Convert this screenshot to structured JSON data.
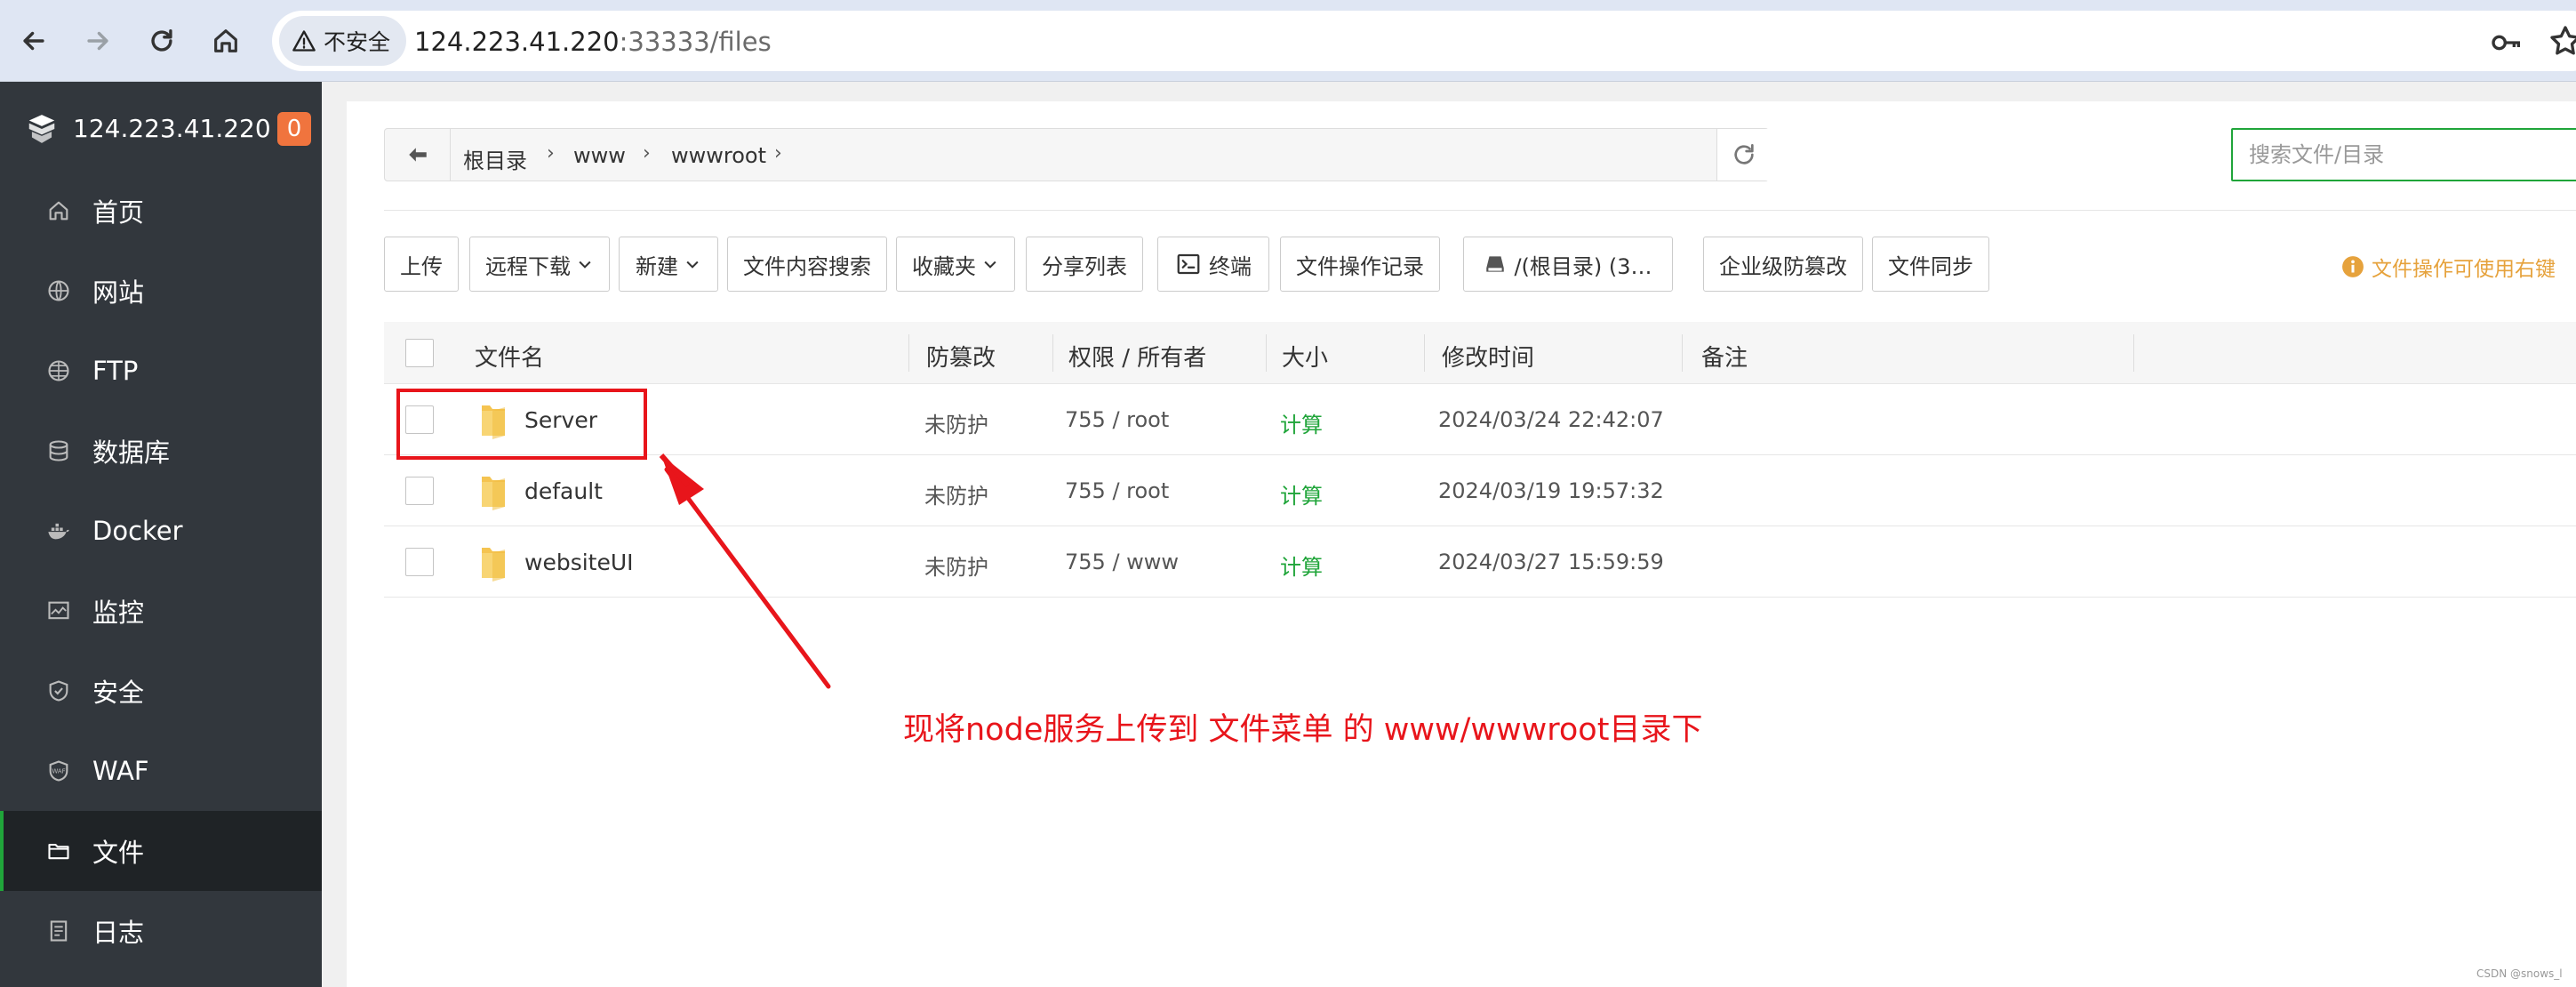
{
  "browser": {
    "security_label": "不安全",
    "url_host": "124.223.41.220",
    "url_rest": ":33333/files"
  },
  "sidebar": {
    "server_ip": "124.223.41.220",
    "badge_count": "0",
    "items": [
      {
        "label": "首页",
        "icon": "home-icon"
      },
      {
        "label": "网站",
        "icon": "globe-icon"
      },
      {
        "label": "FTP",
        "icon": "ftp-globe-icon"
      },
      {
        "label": "数据库",
        "icon": "database-icon"
      },
      {
        "label": "Docker",
        "icon": "docker-icon"
      },
      {
        "label": "监控",
        "icon": "monitor-icon"
      },
      {
        "label": "安全",
        "icon": "shield-icon"
      },
      {
        "label": "WAF",
        "icon": "waf-icon"
      },
      {
        "label": "文件",
        "icon": "folder-icon",
        "active": true
      },
      {
        "label": "日志",
        "icon": "log-icon"
      }
    ]
  },
  "breadcrumb": {
    "items": [
      "根目录",
      "www",
      "wwwroot"
    ]
  },
  "search": {
    "placeholder": "搜索文件/目录"
  },
  "toolbar": {
    "upload": "上传",
    "remote_download": "远程下载",
    "new": "新建",
    "content_search": "文件内容搜索",
    "favorites": "收藏夹",
    "share_list": "分享列表",
    "terminal": "终端",
    "op_log": "文件操作记录",
    "disk": "/(根目录) (3…",
    "tamper": "企业级防篡改",
    "sync": "文件同步",
    "hint": "文件操作可使用右键"
  },
  "table": {
    "headers": {
      "name": "文件名",
      "protect": "防篡改",
      "perm": "权限 / 所有者",
      "size": "大小",
      "mtime": "修改时间",
      "note": "备注"
    },
    "rows": [
      {
        "name": "Server",
        "protect": "未防护",
        "perm": "755 / root",
        "size": "计算",
        "mtime": "2024/03/24 22:42:07"
      },
      {
        "name": "default",
        "protect": "未防护",
        "perm": "755 / root",
        "size": "计算",
        "mtime": "2024/03/19 19:57:32"
      },
      {
        "name": "websiteUI",
        "protect": "未防护",
        "perm": "755 / www",
        "size": "计算",
        "mtime": "2024/03/27 15:59:59"
      }
    ]
  },
  "annotation": {
    "text": "现将node服务上传到 文件菜单 的 www/wwwroot目录下"
  },
  "watermark": "CSDN @snows_l",
  "colors": {
    "accent_green": "#20a53a",
    "sidebar_bg": "#32373d",
    "badge_orange": "#f0743e",
    "annotation_red": "#e8151b",
    "hint_orange": "#e6a23c"
  }
}
